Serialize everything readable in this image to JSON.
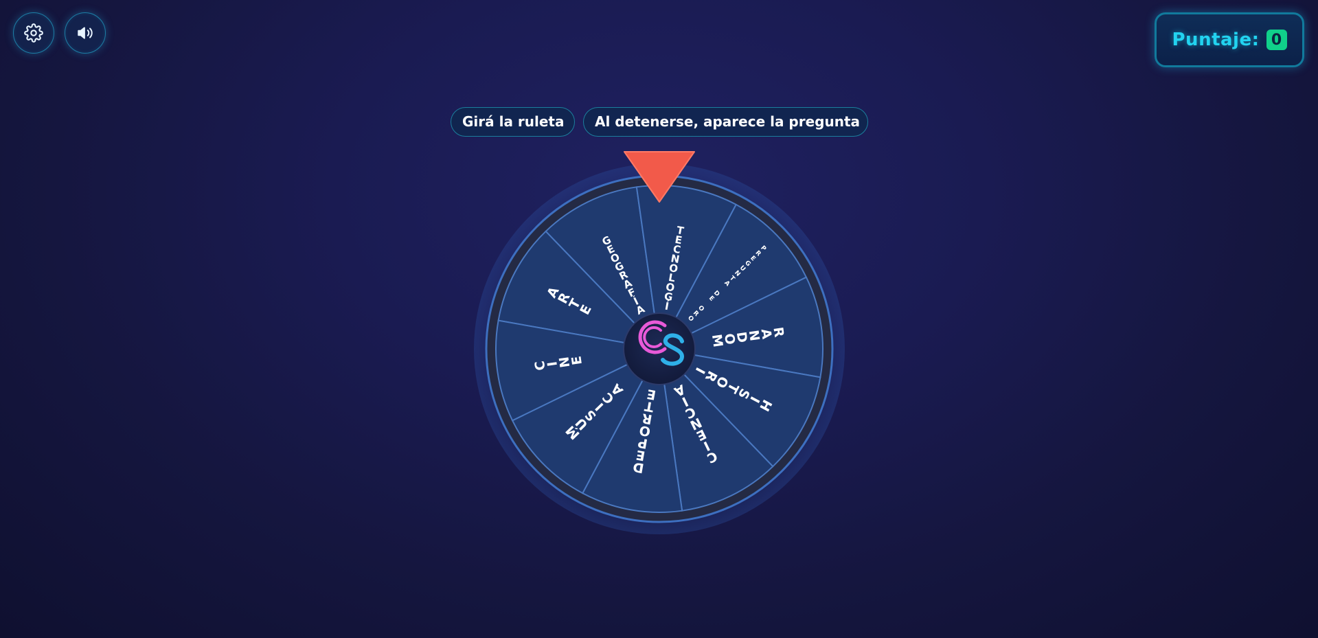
{
  "controls": {
    "settings_icon": "gear-icon",
    "sound_icon": "speaker-icon"
  },
  "score": {
    "label": "Puntaje:",
    "value": "0"
  },
  "instructions": {
    "step1": "Girá la ruleta",
    "step2": "Al detenerse, aparece la pregunta"
  },
  "wheel": {
    "segments": [
      {
        "label": "ARTE"
      },
      {
        "label": "GEOGRAFÍA"
      },
      {
        "label": "TECNOLOGÍA"
      },
      {
        "label": "PREGUNTA DE ORO"
      },
      {
        "label": "RANDOM"
      },
      {
        "label": "HISTORIA"
      },
      {
        "label": "CIENCIA"
      },
      {
        "label": "DEPORTES"
      },
      {
        "label": "MÚSICA"
      },
      {
        "label": "CINE"
      }
    ],
    "center_logo": "CS",
    "colors": {
      "segment": "#1f3a6f",
      "segment_border": "#4a78c0",
      "rim": "#2a2f4a",
      "pointer": "#f25a4a",
      "logo_c": "#e85ad8",
      "logo_s": "#2fb0e8"
    }
  },
  "colors": {
    "accent": "#22d3f0",
    "score_badge": "#10d08a"
  }
}
